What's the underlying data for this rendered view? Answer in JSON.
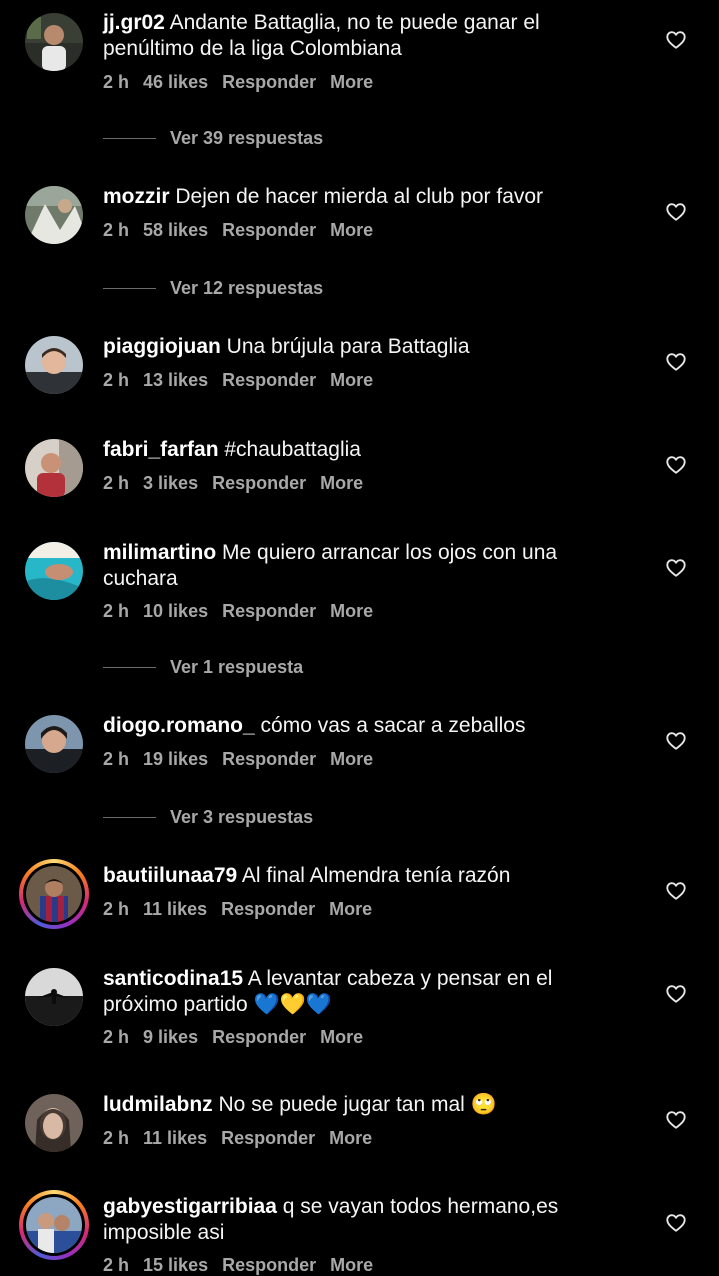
{
  "comments": [
    {
      "username": "jj.gr02",
      "text": "Andante Battaglia, no te puede ganar el penúltimo de la liga Colombiana",
      "time": "2 h",
      "likes": "46 likes",
      "reply_label": "Responder",
      "more_label": "More",
      "replies_label": "Ver 39 respuestas"
    },
    {
      "username": "mozzir",
      "text": "Dejen de hacer mierda al club por favor",
      "time": "2 h",
      "likes": "58 likes",
      "reply_label": "Responder",
      "more_label": "More",
      "replies_label": "Ver 12 respuestas"
    },
    {
      "username": "piaggiojuan",
      "text": "Una brújula para Battaglia",
      "time": "2 h",
      "likes": "13 likes",
      "reply_label": "Responder",
      "more_label": "More"
    },
    {
      "username": "fabri_farfan",
      "text": "#chaubattaglia",
      "time": "2 h",
      "likes": "3 likes",
      "reply_label": "Responder",
      "more_label": "More"
    },
    {
      "username": "milimartino",
      "text": "Me quiero arrancar los ojos con una cuchara",
      "time": "2 h",
      "likes": "10 likes",
      "reply_label": "Responder",
      "more_label": "More",
      "replies_label": "Ver 1 respuesta"
    },
    {
      "username": "diogo.romano_",
      "text": "cómo vas a sacar a zeballos",
      "time": "2 h",
      "likes": "19 likes",
      "reply_label": "Responder",
      "more_label": "More",
      "replies_label": "Ver 3 respuestas"
    },
    {
      "username": "bautiilunaa79",
      "text": "Al final Almendra tenía razón",
      "time": "2 h",
      "likes": "11 likes",
      "reply_label": "Responder",
      "more_label": "More"
    },
    {
      "username": "santicodina15",
      "text": "A levantar cabeza y pensar en el próximo partido 💙💛💙",
      "time": "2 h",
      "likes": "9 likes",
      "reply_label": "Responder",
      "more_label": "More"
    },
    {
      "username": "ludmilabnz",
      "text": "No se puede jugar tan mal 🙄",
      "time": "2 h",
      "likes": "11 likes",
      "reply_label": "Responder",
      "more_label": "More"
    },
    {
      "username": "gabyestigarribiaa",
      "text": "q se vayan todos hermano,es imposible asi",
      "time": "2 h",
      "likes": "15 likes",
      "reply_label": "Responder",
      "more_label": "More"
    }
  ],
  "icons": {
    "like": "heart-outline-icon"
  },
  "colors": {
    "background": "#000000",
    "primary_text": "#f5f5f5",
    "secondary_text": "#a8a8a8",
    "story_ring": "#d62976"
  }
}
